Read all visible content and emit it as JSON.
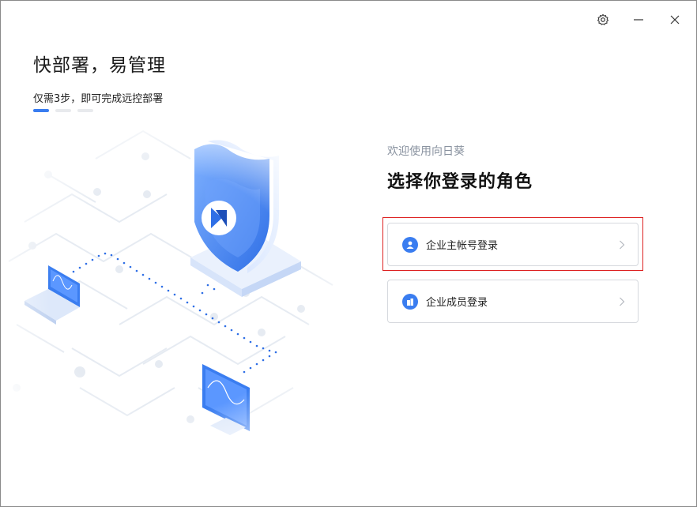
{
  "window": {
    "controls": {
      "settings_icon": "gear-icon",
      "minimize_icon": "minimize-icon",
      "close_icon": "close-icon"
    }
  },
  "left": {
    "headline": "快部署，易管理",
    "subline": "仅需3步，即可完成远控部署",
    "steps": {
      "total": 3,
      "current": 1
    }
  },
  "right": {
    "welcome": "欢迎使用向日葵",
    "title": "选择你登录的角色",
    "roles": [
      {
        "label": "企业主帐号登录",
        "icon": "user-icon",
        "selected": true
      },
      {
        "label": "企业成员登录",
        "icon": "building-icon",
        "selected": false
      }
    ]
  },
  "colors": {
    "accent": "#3a7df0",
    "highlight_border": "#dd2222"
  }
}
